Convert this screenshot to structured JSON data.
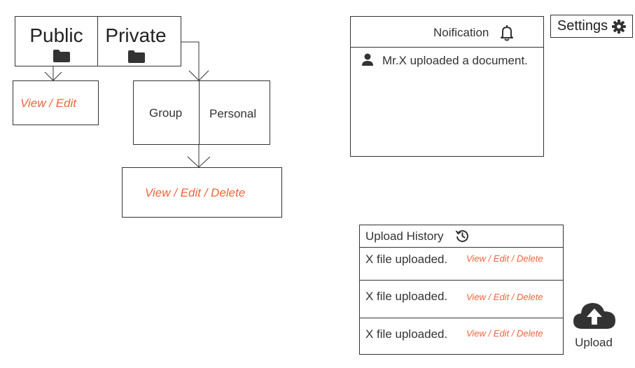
{
  "access": {
    "public_label": "Public",
    "private_label": "Private",
    "public_action": "View / Edit",
    "private_types": {
      "group": "Group",
      "personal": "Personal"
    },
    "private_action": "View / Edit / Delete"
  },
  "notification": {
    "title": "Noification",
    "items": [
      {
        "text": "Mr.X uploaded a document."
      }
    ]
  },
  "settings": {
    "label": "Settings"
  },
  "upload_history": {
    "title": "Upload History",
    "rows": [
      {
        "text": "X file uploaded.",
        "actions": "View / Edit / Delete"
      },
      {
        "text": "X file uploaded.",
        "actions": "View / Edit / Delete"
      },
      {
        "text": "X file uploaded.",
        "actions": "View / Edit / Delete"
      }
    ]
  },
  "upload": {
    "label": "Upload"
  },
  "colors": {
    "accent": "#f0643c",
    "icon": "#333333",
    "border": "#333333"
  },
  "icons": [
    "folder-icon",
    "bell-icon",
    "user-icon",
    "gear-icon",
    "history-icon",
    "cloud-upload-icon"
  ]
}
